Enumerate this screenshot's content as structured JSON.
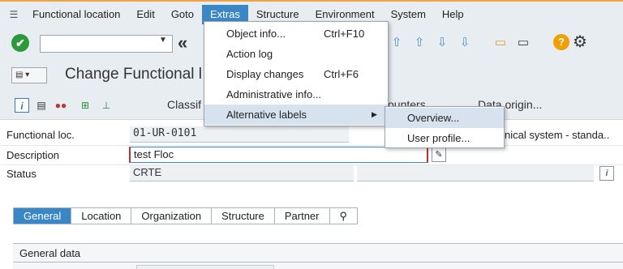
{
  "menubar": {
    "items": [
      "Functional location",
      "Edit",
      "Goto",
      "Extras",
      "Structure",
      "Environment",
      "System",
      "Help"
    ]
  },
  "toolbar": {
    "command_value": ""
  },
  "title": {
    "text": "Change Functional l"
  },
  "apptoolbar": {
    "classif": "Classif",
    "counters": "ounters",
    "data_origin": "Data origin..."
  },
  "form": {
    "functional_loc_label": "Functional loc.",
    "functional_loc_value": "01-UR-0101",
    "structure_text": "nical system - standa..",
    "description_label": "Description",
    "description_value": "test Floc",
    "status_label": "Status",
    "status_value": "CRTE"
  },
  "tabs": [
    "General",
    "Location",
    "Organization",
    "Structure",
    "Partner"
  ],
  "section": {
    "title": "General data"
  },
  "extras_menu": {
    "items": [
      {
        "label": "Object info...",
        "shortcut": "Ctrl+F10"
      },
      {
        "label": "Action log",
        "shortcut": ""
      },
      {
        "label": "Display changes",
        "shortcut": "Ctrl+F6"
      },
      {
        "label": "Administrative info...",
        "shortcut": ""
      },
      {
        "label": "Alternative labels",
        "shortcut": ""
      }
    ]
  },
  "submenu": {
    "items": [
      "Overview...",
      "User profile..."
    ]
  },
  "colors": {
    "accent": "#3a87c8",
    "menu_highlight": "#d6e3ef",
    "top_border": "#f0a34a"
  }
}
